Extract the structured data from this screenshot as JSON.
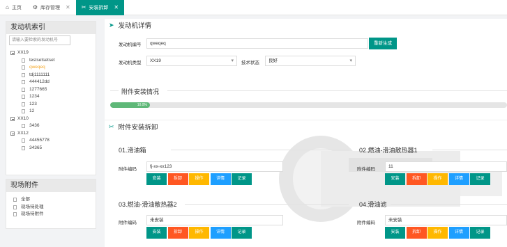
{
  "tabs": [
    {
      "icon": "home-icon",
      "label": "主页"
    },
    {
      "icon": "gear-icon",
      "label": "库存管理"
    },
    {
      "icon": "tools-icon",
      "label": "安装拆卸"
    }
  ],
  "index_panel": {
    "title": "发动机索引",
    "search_placeholder": "请输入要检索的发动机号",
    "tree": [
      {
        "label": "XX19",
        "type": "folder"
      },
      {
        "label": "testsetsetset",
        "type": "leaf"
      },
      {
        "label": "qweqeq",
        "type": "leaf",
        "selected": true
      },
      {
        "label": "tdj1111111",
        "type": "leaf"
      },
      {
        "label": "444412dd",
        "type": "leaf"
      },
      {
        "label": "1277665",
        "type": "leaf"
      },
      {
        "label": "1234",
        "type": "leaf"
      },
      {
        "label": "123",
        "type": "leaf"
      },
      {
        "label": "12",
        "type": "leaf"
      },
      {
        "label": "XX10",
        "type": "folder"
      },
      {
        "label": "3436",
        "type": "leaf"
      },
      {
        "label": "XX12",
        "type": "folder"
      },
      {
        "label": "44455778",
        "type": "leaf"
      },
      {
        "label": "34365",
        "type": "leaf"
      }
    ]
  },
  "accessory_panel": {
    "title": "现场附件",
    "items": [
      "全部",
      "现场待处理",
      "现场待附件"
    ]
  },
  "detail": {
    "title": "发动机详情",
    "engine_no_label": "发动机编号",
    "engine_no_value": "qweqeq",
    "regen_button": "重新生成",
    "engine_type_label": "发动机类型",
    "engine_type_value": "XX19",
    "tech_state_label": "技术状态",
    "tech_state_value": "良好"
  },
  "install_status": {
    "title": "附件安装情况",
    "progress": 10,
    "progress_label": "10.0%"
  },
  "install_section": {
    "title": "附件安装拆卸",
    "field_label": "附件编码",
    "buttons": [
      "安装",
      "拆卸",
      "操作",
      "详情",
      "记录"
    ],
    "cards": [
      {
        "title": "01.滑油箱",
        "value": "fj-xx-xx123"
      },
      {
        "title": "02.燃油-滑油散热器1",
        "value": "11"
      },
      {
        "title": "03.燃油-滑油散热器2",
        "value": "未安装"
      },
      {
        "title": "04.滑油滤",
        "value": "未安装"
      }
    ]
  },
  "colors": {
    "teal": "#009688",
    "red": "#ff5722",
    "yellow": "#ffb800",
    "blue": "#1e9fff",
    "green": "#5fb878"
  }
}
